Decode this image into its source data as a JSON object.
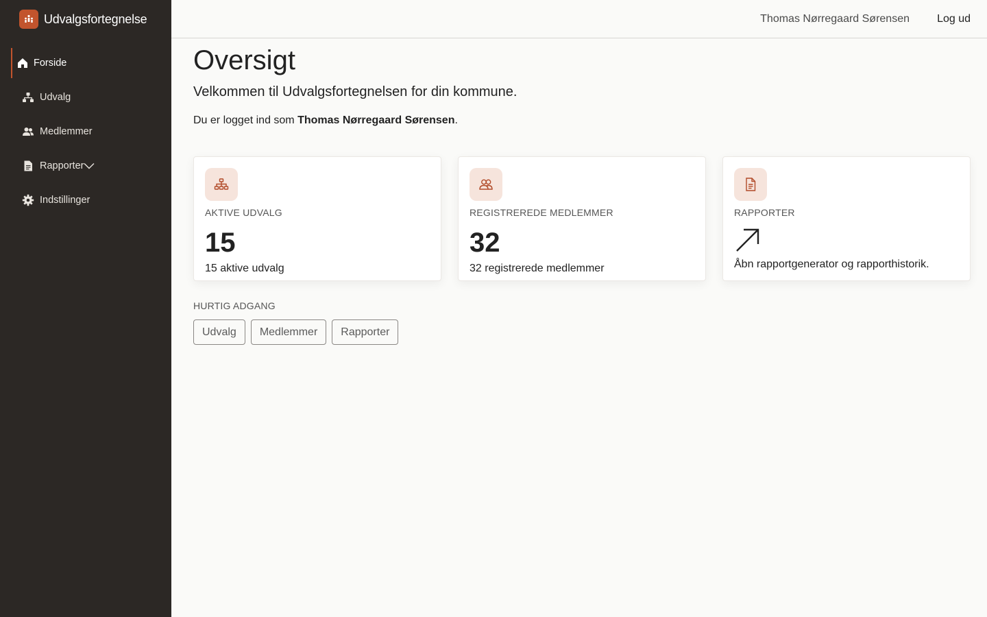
{
  "app": {
    "name": "Udvalgsfortegnelse",
    "brand_color": "#c2542d",
    "sidebar_bg": "#2c2825"
  },
  "sidebar": {
    "items": [
      {
        "label": "Forside",
        "icon": "home-icon",
        "active": true
      },
      {
        "label": "Udvalg",
        "icon": "org-chart-icon"
      },
      {
        "label": "Medlemmer",
        "icon": "users-icon"
      },
      {
        "label": "Rapporter",
        "icon": "document-icon",
        "has_submenu": true
      },
      {
        "label": "Indstillinger",
        "icon": "gear-icon"
      }
    ]
  },
  "header": {
    "user_name": "Thomas Nørregaard Sørensen",
    "logout_label": "Log ud"
  },
  "main": {
    "title": "Oversigt",
    "subtitle": "Velkommen til Udvalgsfortegnelsen for din kommune.",
    "logged_in_prefix": "Du er logget ind som ",
    "logged_in_user": "Thomas Nørregaard Sørensen",
    "logged_in_suffix": ".",
    "cards": [
      {
        "label": "AKTIVE UDVALG",
        "value": "15",
        "description": "15 aktive udvalg",
        "icon": "org-chart-icon"
      },
      {
        "label": "REGISTREREDE MEDLEMMER",
        "value": "32",
        "description": "32 registrerede medlemmer",
        "icon": "users-icon"
      },
      {
        "label": "RAPPORTER",
        "description": "Åbn rapportgenerator og rapporthistorik.",
        "icon": "document-icon",
        "link_icon": "arrow-up-right-icon"
      }
    ],
    "quick_access": {
      "title": "HURTIG ADGANG",
      "buttons": [
        "Udvalg",
        "Medlemmer",
        "Rapporter"
      ]
    }
  }
}
